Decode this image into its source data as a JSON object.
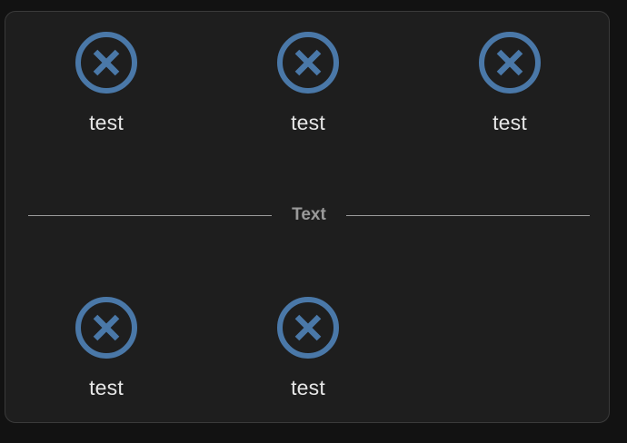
{
  "colors": {
    "icon_accent": "#4a78a8",
    "label": "#e6e6e6",
    "divider": "#9a9a9a",
    "card_bg": "#1e1e1e",
    "page_bg": "#121212"
  },
  "top_row": {
    "items": [
      {
        "label": "test",
        "icon": "close-circle-icon"
      },
      {
        "label": "test",
        "icon": "close-circle-icon"
      },
      {
        "label": "test",
        "icon": "close-circle-icon"
      }
    ]
  },
  "divider": {
    "text": "Text"
  },
  "bottom_row": {
    "items": [
      {
        "label": "test",
        "icon": "close-circle-icon"
      },
      {
        "label": "test",
        "icon": "close-circle-icon"
      }
    ]
  }
}
